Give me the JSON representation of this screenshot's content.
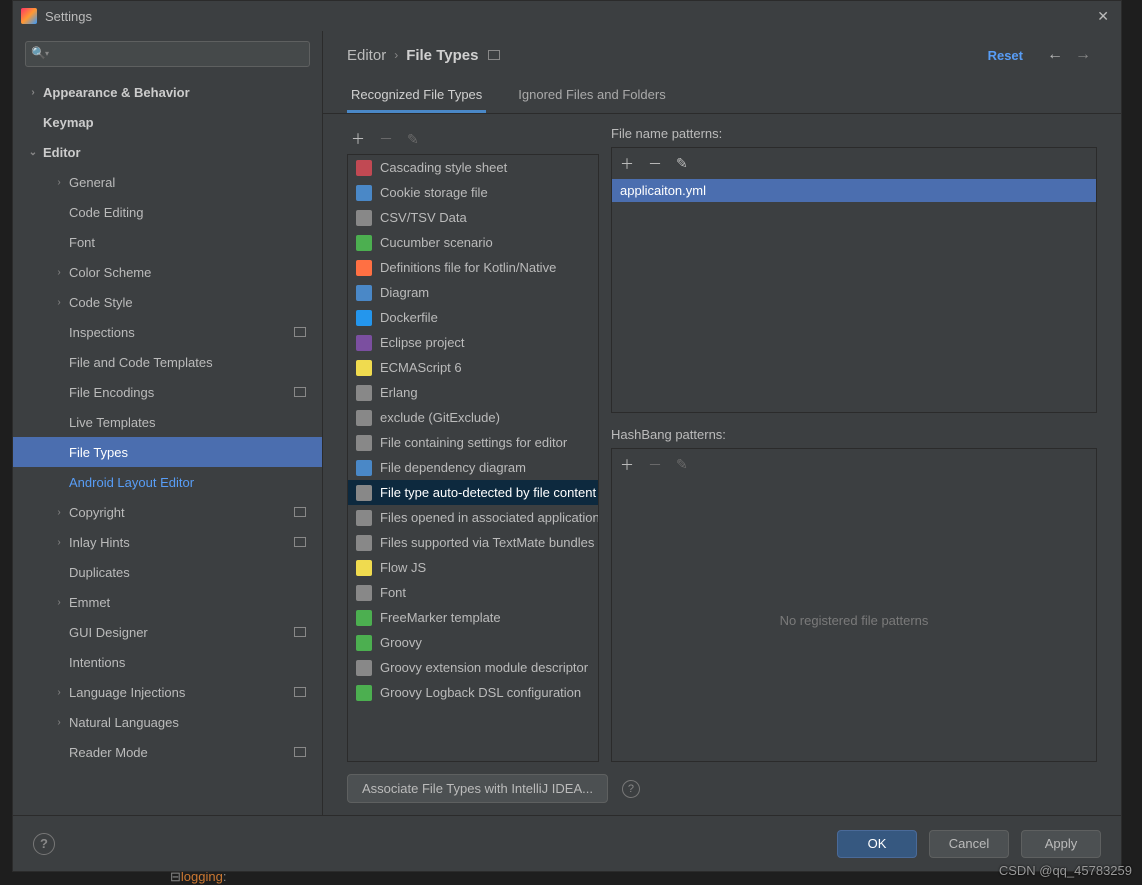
{
  "title": "Settings",
  "breadcrumb": {
    "root": "Editor",
    "current": "File Types"
  },
  "reset_label": "Reset",
  "tabs": {
    "recognized": "Recognized File Types",
    "ignored": "Ignored Files and Folders"
  },
  "sidebar": [
    {
      "label": "Appearance & Behavior",
      "indent": 0,
      "arrow": ">",
      "bold": true
    },
    {
      "label": "Keymap",
      "indent": 0,
      "bold": true
    },
    {
      "label": "Editor",
      "indent": 0,
      "arrow": "v",
      "bold": true
    },
    {
      "label": "General",
      "indent": 1,
      "arrow": ">"
    },
    {
      "label": "Code Editing",
      "indent": 1
    },
    {
      "label": "Font",
      "indent": 1
    },
    {
      "label": "Color Scheme",
      "indent": 1,
      "arrow": ">"
    },
    {
      "label": "Code Style",
      "indent": 1,
      "arrow": ">"
    },
    {
      "label": "Inspections",
      "indent": 1,
      "badge": true
    },
    {
      "label": "File and Code Templates",
      "indent": 1
    },
    {
      "label": "File Encodings",
      "indent": 1,
      "badge": true
    },
    {
      "label": "Live Templates",
      "indent": 1
    },
    {
      "label": "File Types",
      "indent": 1,
      "selected": true
    },
    {
      "label": "Android Layout Editor",
      "indent": 1,
      "link": true
    },
    {
      "label": "Copyright",
      "indent": 1,
      "arrow": ">",
      "badge": true
    },
    {
      "label": "Inlay Hints",
      "indent": 1,
      "arrow": ">",
      "badge": true
    },
    {
      "label": "Duplicates",
      "indent": 1
    },
    {
      "label": "Emmet",
      "indent": 1,
      "arrow": ">"
    },
    {
      "label": "GUI Designer",
      "indent": 1,
      "badge": true
    },
    {
      "label": "Intentions",
      "indent": 1
    },
    {
      "label": "Language Injections",
      "indent": 1,
      "arrow": ">",
      "badge": true
    },
    {
      "label": "Natural Languages",
      "indent": 1,
      "arrow": ">"
    },
    {
      "label": "Reader Mode",
      "indent": 1,
      "badge": true
    }
  ],
  "file_types": [
    {
      "label": "Cascading style sheet",
      "color": "#c14953"
    },
    {
      "label": "Cookie storage file",
      "color": "#4a88c7"
    },
    {
      "label": "CSV/TSV Data",
      "color": "#888"
    },
    {
      "label": "Cucumber scenario",
      "color": "#4caf50"
    },
    {
      "label": "Definitions file for Kotlin/Native",
      "color": "#ff7043"
    },
    {
      "label": "Diagram",
      "color": "#4a88c7"
    },
    {
      "label": "Dockerfile",
      "color": "#2496ed"
    },
    {
      "label": "Eclipse project",
      "color": "#7b4fa0"
    },
    {
      "label": "ECMAScript 6",
      "color": "#f0db4f"
    },
    {
      "label": "Erlang",
      "color": "#888"
    },
    {
      "label": "exclude (GitExclude)",
      "color": "#888"
    },
    {
      "label": "File containing settings for editor",
      "color": "#888"
    },
    {
      "label": "File dependency diagram",
      "color": "#4a88c7"
    },
    {
      "label": "File type auto-detected by file content",
      "color": "#888",
      "selected": true
    },
    {
      "label": "Files opened in associated applications",
      "color": "#888"
    },
    {
      "label": "Files supported via TextMate bundles",
      "color": "#888"
    },
    {
      "label": "Flow JS",
      "color": "#f0db4f"
    },
    {
      "label": "Font",
      "color": "#888"
    },
    {
      "label": "FreeMarker template",
      "color": "#4caf50"
    },
    {
      "label": "Groovy",
      "color": "#4caf50"
    },
    {
      "label": "Groovy extension module descriptor",
      "color": "#888"
    },
    {
      "label": "Groovy Logback DSL configuration",
      "color": "#4caf50"
    }
  ],
  "file_patterns_label": "File name patterns:",
  "file_patterns": [
    "applicaiton.yml"
  ],
  "hashbang_label": "HashBang patterns:",
  "hashbang_empty": "No registered file patterns",
  "assoc_btn": "Associate File Types with IntelliJ IDEA...",
  "buttons": {
    "ok": "OK",
    "cancel": "Cancel",
    "apply": "Apply"
  },
  "watermark": "CSDN @qq_45783259",
  "code_snippet": {
    "brace": "⊟",
    "keyword": "logging",
    ":": ":"
  }
}
